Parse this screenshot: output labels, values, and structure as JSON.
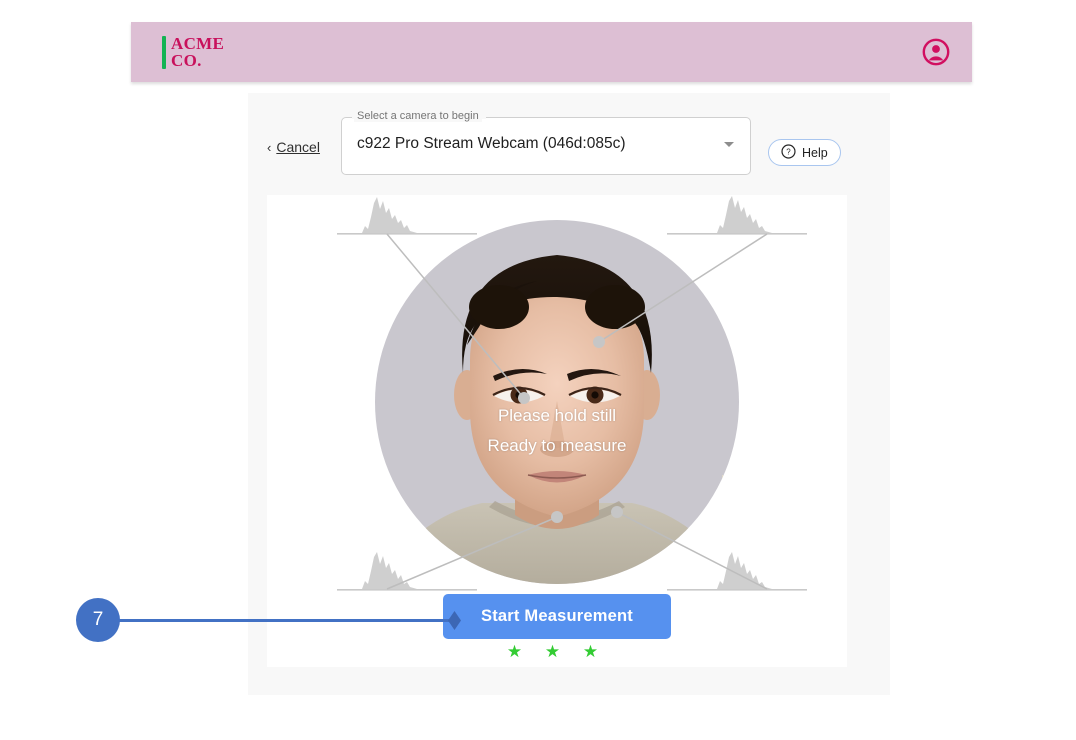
{
  "header": {
    "brand_line1": "ACME",
    "brand_line2": "CO.",
    "brand_accent_color": "#13b353",
    "brand_text_color": "#c8115c",
    "background_color": "#ddbfd4",
    "avatar_icon": "user-circle-icon"
  },
  "controls": {
    "cancel_chevron": "‹",
    "cancel_label": "Cancel",
    "camera_select": {
      "label": "Select a camera to begin",
      "value": "c922 Pro Stream Webcam (046d:085c)",
      "placeholder": "Select a camera to begin",
      "arrow_icon": "chevron-down-icon"
    },
    "help": {
      "label": "Help",
      "icon": "question-circle-icon",
      "border_color": "#a9c6ef"
    }
  },
  "video": {
    "overlay_line1": "Please hold still",
    "overlay_line2": "Ready to measure",
    "landmark_count": 4,
    "histogram_count": 4
  },
  "actions": {
    "start_label": "Start Measurement",
    "start_color": "#5691ef",
    "stars": "★ ★ ★",
    "stars_color": "#33cc33"
  },
  "callout": {
    "number": "7",
    "color": "#4271c4"
  }
}
